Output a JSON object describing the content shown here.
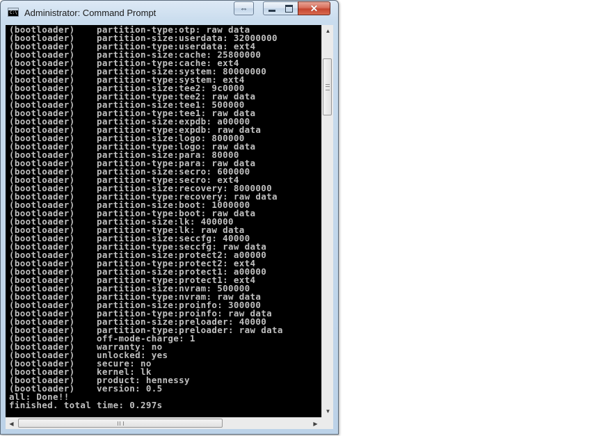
{
  "window": {
    "title": "Administrator: Command Prompt",
    "title_icon_glyph": "C:\\"
  },
  "titlebar": {
    "swap_icon": "⇔",
    "close_icon": "✕"
  },
  "console": {
    "lines": [
      "(bootloader)    partition-type:otp: raw data",
      "(bootloader)    partition-size:userdata: 32000000",
      "(bootloader)    partition-type:userdata: ext4",
      "(bootloader)    partition-size:cache: 25800000",
      "(bootloader)    partition-type:cache: ext4",
      "(bootloader)    partition-size:system: 80000000",
      "(bootloader)    partition-type:system: ext4",
      "(bootloader)    partition-size:tee2: 9c0000",
      "(bootloader)    partition-type:tee2: raw data",
      "(bootloader)    partition-size:tee1: 500000",
      "(bootloader)    partition-type:tee1: raw data",
      "(bootloader)    partition-size:expdb: a00000",
      "(bootloader)    partition-type:expdb: raw data",
      "(bootloader)    partition-size:logo: 800000",
      "(bootloader)    partition-type:logo: raw data",
      "(bootloader)    partition-size:para: 80000",
      "(bootloader)    partition-type:para: raw data",
      "(bootloader)    partition-size:secro: 600000",
      "(bootloader)    partition-type:secro: ext4",
      "(bootloader)    partition-size:recovery: 8000000",
      "(bootloader)    partition-type:recovery: raw data",
      "(bootloader)    partition-size:boot: 1000000",
      "(bootloader)    partition-type:boot: raw data",
      "(bootloader)    partition-size:lk: 400000",
      "(bootloader)    partition-type:lk: raw data",
      "(bootloader)    partition-size:seccfg: 40000",
      "(bootloader)    partition-type:seccfg: raw data",
      "(bootloader)    partition-size:protect2: a00000",
      "(bootloader)    partition-type:protect2: ext4",
      "(bootloader)    partition-size:protect1: a00000",
      "(bootloader)    partition-type:protect1: ext4",
      "(bootloader)    partition-size:nvram: 500000",
      "(bootloader)    partition-type:nvram: raw data",
      "(bootloader)    partition-size:proinfo: 300000",
      "(bootloader)    partition-type:proinfo: raw data",
      "(bootloader)    partition-size:preloader: 40000",
      "(bootloader)    partition-type:preloader: raw data",
      "(bootloader)    off-mode-charge: 1",
      "(bootloader)    warranty: no",
      "(bootloader)    unlocked: yes",
      "(bootloader)    secure: no",
      "(bootloader)    kernel: lk",
      "(bootloader)    product: hennessy",
      "(bootloader)    version: 0.5",
      "all: Done!!",
      "finished. total time: 0.297s"
    ]
  },
  "scrollbars": {
    "up_arrow": "▲",
    "down_arrow": "▼",
    "left_arrow": "◀",
    "right_arrow": "▶",
    "vertical_position": 0.07,
    "horizontal_position": 0.0
  },
  "colors": {
    "console_bg": "#000000",
    "console_text": "#c0c0c0",
    "close_button": "#c54630"
  }
}
